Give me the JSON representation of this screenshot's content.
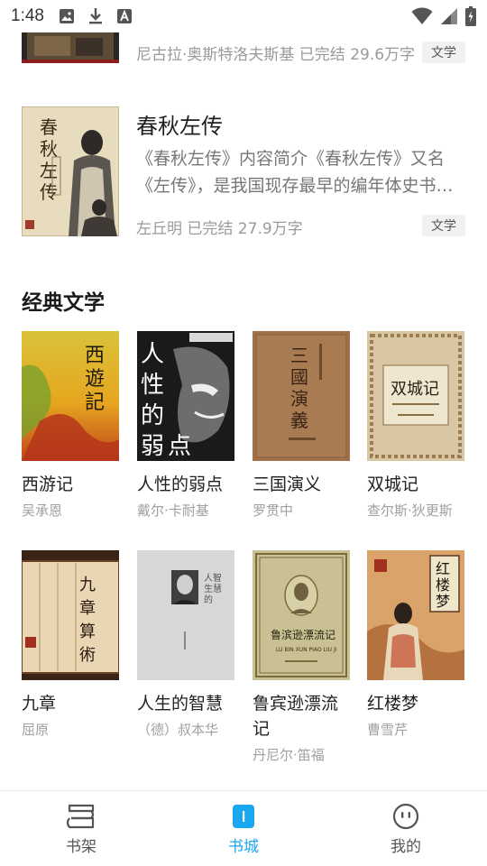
{
  "status_bar": {
    "time": "1:48",
    "left_icons": [
      "image-icon",
      "download-icon",
      "a-app-icon"
    ],
    "right_icons": [
      "wifi-icon",
      "signal-icon",
      "battery-icon"
    ]
  },
  "top_book": {
    "meta": "尼古拉·奥斯特洛夫斯基 已完结 29.6万字",
    "tag": "文学"
  },
  "featured_book": {
    "title": "春秋左传",
    "desc_line1": "《春秋左传》内容简介《春秋左传》又名",
    "desc_line2": "《左传》，是我国现存最早的编年体史书，相传是春秋末年鲁国史官左丘明所作",
    "meta": "左丘明 已完结 27.9万字",
    "tag": "文学",
    "cover_text": "春秋左传"
  },
  "section": {
    "title": "经典文学"
  },
  "grid_books": [
    {
      "name": "西游记",
      "author": "吴承恩",
      "cover_text": "西游记"
    },
    {
      "name": "人性的弱点",
      "author": "戴尔·卡耐基",
      "cover_text": "人性的弱点"
    },
    {
      "name": "三国演义",
      "author": "罗贯中",
      "cover_text": "三国演義"
    },
    {
      "name": "双城记",
      "author": "查尔斯·狄更斯",
      "cover_text": "双城记"
    },
    {
      "name": "九章",
      "author": "屈原",
      "cover_text": "九章算術"
    },
    {
      "name": "人生的智慧",
      "author": "（德）叔本华",
      "cover_text": "人生的智慧"
    },
    {
      "name": "鲁宾逊漂流记",
      "author": "丹尼尔·笛福",
      "cover_text": "鲁滨逊漂流记"
    },
    {
      "name": "红楼梦",
      "author": "曹雪芹",
      "cover_text": "红楼梦"
    }
  ],
  "bottom_nav": {
    "items": [
      {
        "label": "书架",
        "icon": "bookshelf-icon"
      },
      {
        "label": "书城",
        "icon": "bookstore-icon",
        "active": true
      },
      {
        "label": "我的",
        "icon": "profile-face-icon"
      }
    ],
    "active_color": "#19a7f0"
  }
}
